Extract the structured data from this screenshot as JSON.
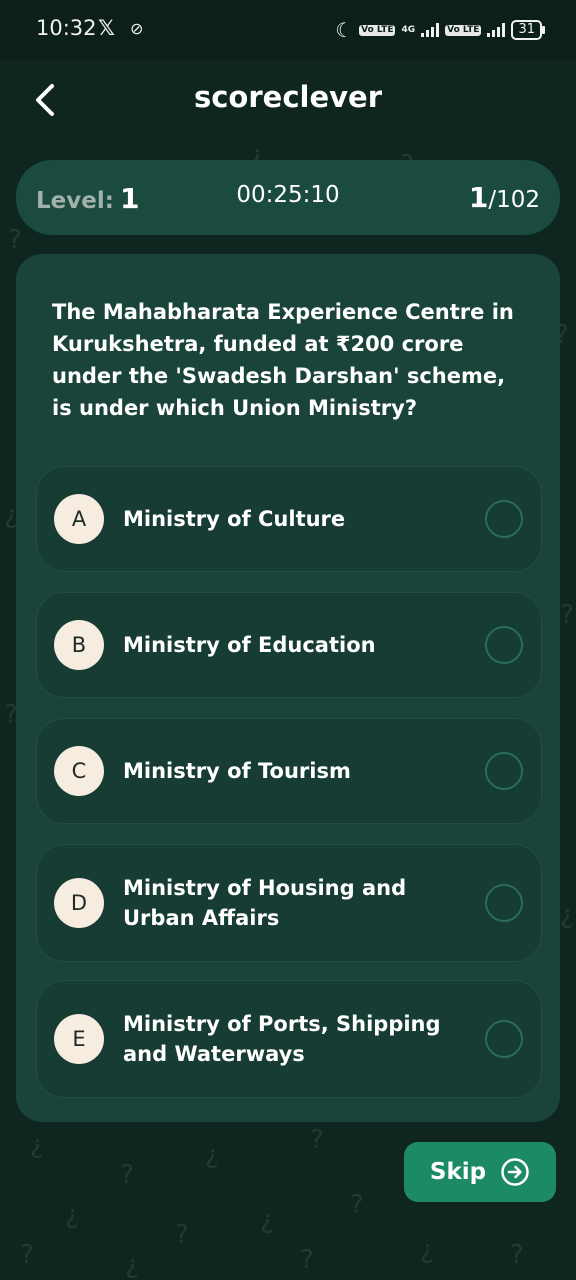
{
  "status_bar": {
    "time": "10:32",
    "x_glyph": "𝕏",
    "link_glyph": "⊘",
    "moon_glyph": "☾",
    "volte_label": "Vo LTE",
    "network_label": "4G",
    "battery": "31"
  },
  "header": {
    "title": "scoreclever",
    "back_icon": "chevron-left-icon"
  },
  "level_bar": {
    "level_label": "Level:",
    "level_value": "1",
    "timer": "00:25:10",
    "current": "1",
    "total": "/102"
  },
  "question": {
    "text": "The Mahabharata Experience Centre in Kurukshetra, funded at ₹200 crore under the 'Swadesh Darshan' scheme, is under which Union Ministry?"
  },
  "options": [
    {
      "letter": "A",
      "label": "Ministry of Culture"
    },
    {
      "letter": "B",
      "label": "Ministry of Education"
    },
    {
      "letter": "C",
      "label": "Ministry of Tourism"
    },
    {
      "letter": "D",
      "label": "Ministry of Housing and Urban Affairs"
    },
    {
      "letter": "E",
      "label": "Ministry of Ports, Shipping and Waterways"
    }
  ],
  "skip": {
    "label": "Skip",
    "icon": "arrow-right-circle-icon"
  },
  "colors": {
    "background": "#0f2620",
    "card": "#1a4339",
    "accent": "#1c8a63",
    "badge": "#f6ecdf"
  }
}
